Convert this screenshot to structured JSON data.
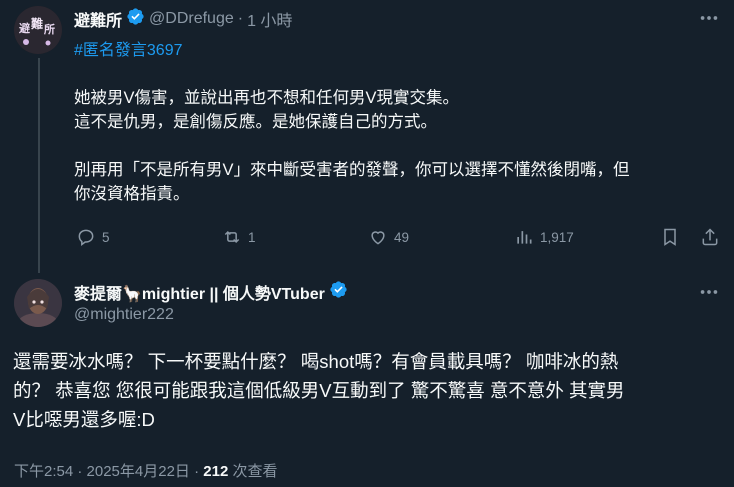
{
  "parent": {
    "name": "避難所",
    "handle": "@DDrefuge",
    "separator": "·",
    "time": "1 小時",
    "hashtag": "#匿名發言3697",
    "lines": [
      "她被男V傷害，並說出再也不想和任何男V現實交集。",
      "這不是仇男，是創傷反應。是她保護自己的方式。",
      "別再用「不是所有男V」來中斷受害者的發聲，你可以選擇不懂然後閉嘴，但",
      "你沒資格指責。"
    ],
    "actions": {
      "replies": "5",
      "reposts": "1",
      "likes": "49",
      "views": "1,917"
    }
  },
  "reply": {
    "name": "麥提爾🦙mightier || 個人勢VTuber",
    "handle": "@mightier222",
    "lines": [
      "還需要冰水嗎？ 下一杯要點什麼？ 喝shot嗎？有會員載具嗎？ 咖啡冰的熱",
      "的？ 恭喜您 您很可能跟我這個低級男V互動到了 驚不驚喜 意不意外 其實男",
      "V比噁男還多喔:D"
    ],
    "timestamp": "下午2:54 · 2025年4月22日 · ",
    "views_count": "212",
    "views_label": " 次查看"
  },
  "icons": {
    "accent": "#1d9bf0",
    "muted": "#8b98a5",
    "background": "#15202b"
  }
}
